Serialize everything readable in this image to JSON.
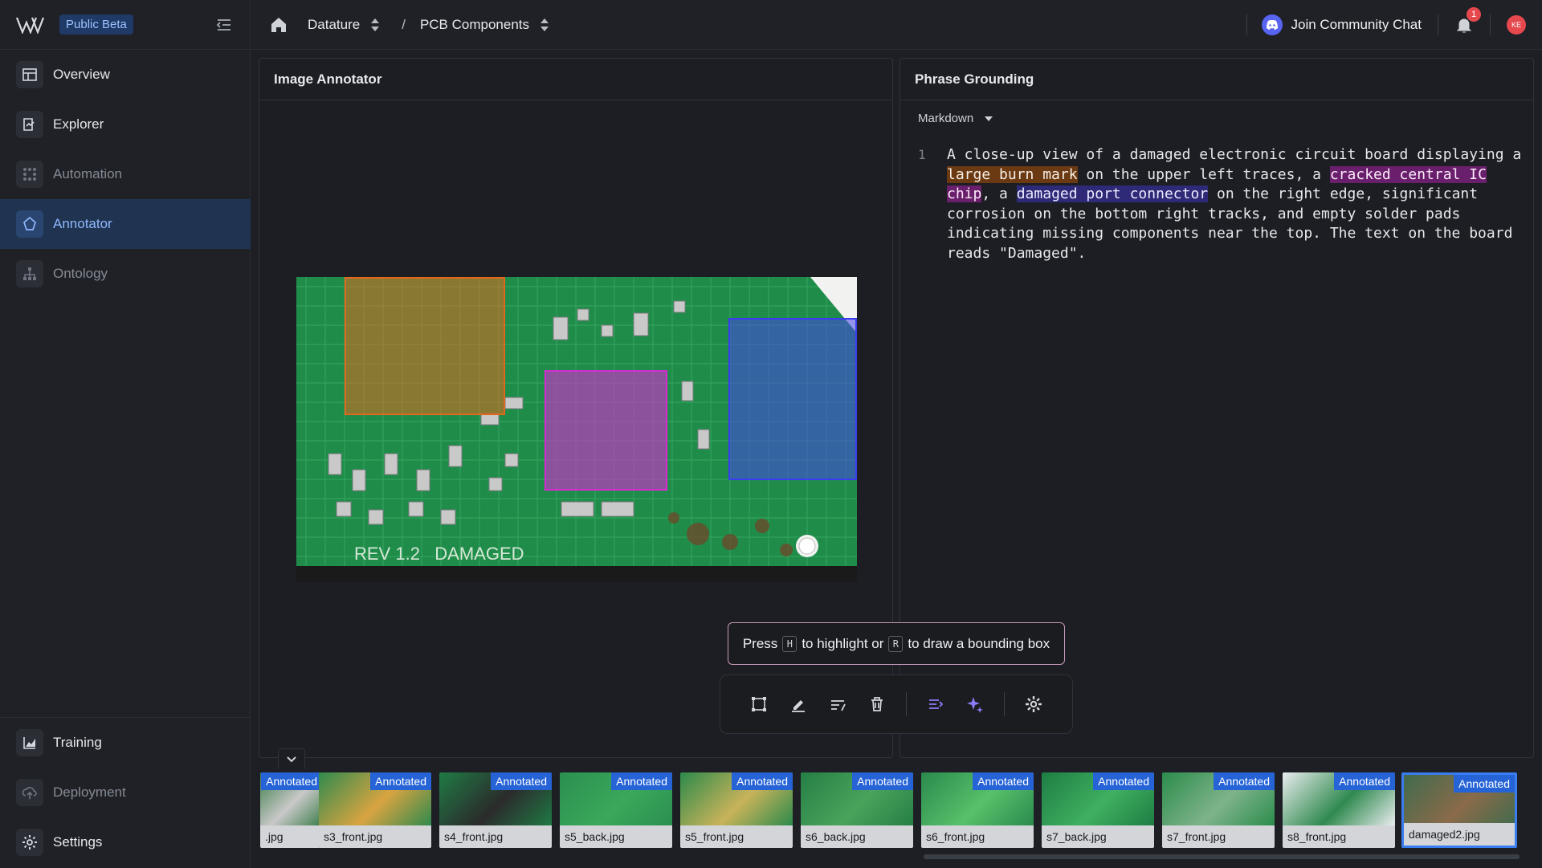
{
  "app": {
    "badge": "Public Beta"
  },
  "sidebar": {
    "items": [
      {
        "label": "Overview"
      },
      {
        "label": "Explorer"
      },
      {
        "label": "Automation"
      },
      {
        "label": "Annotator"
      },
      {
        "label": "Ontology"
      }
    ],
    "bottom_items": [
      {
        "label": "Training"
      },
      {
        "label": "Deployment"
      },
      {
        "label": "Settings"
      }
    ]
  },
  "topbar": {
    "breadcrumb": [
      "Datature",
      "PCB Components"
    ],
    "separator": "/",
    "community": "Join Community Chat",
    "notifications": "1",
    "avatar": "KE"
  },
  "annotator": {
    "title": "Image Annotator",
    "image_text": "REV 1.2   DAMAGED",
    "hint": {
      "prefix": "Press",
      "key1": "H",
      "middle": "to highlight or",
      "key2": "R",
      "suffix": "to draw a bounding box"
    }
  },
  "grounding": {
    "title": "Phrase Grounding",
    "format": "Markdown",
    "line_number": "1",
    "text": {
      "p1": "A close-up view of a damaged electronic circuit board displaying a ",
      "h1": "large burn mark",
      "p2": " on the upper left traces, a ",
      "h2": "cracked central IC chip",
      "p3": ", a ",
      "h3": "damaged port connector",
      "p4": " on the right edge, significant corrosion on the bottom right tracks, and empty solder pads indicating missing components near the top. The text on the board reads \"Damaged\"."
    }
  },
  "colors": {
    "burn": "#e0681e",
    "chip": "#d62bd2",
    "connector": "#3b3bf0",
    "accent": "#2563d6"
  },
  "filmstrip": {
    "status": "Annotated",
    "items": [
      {
        "name": ".jpg"
      },
      {
        "name": "s3_front.jpg"
      },
      {
        "name": "s4_front.jpg"
      },
      {
        "name": "s5_back.jpg"
      },
      {
        "name": "s5_front.jpg"
      },
      {
        "name": "s6_back.jpg"
      },
      {
        "name": "s6_front.jpg"
      },
      {
        "name": "s7_back.jpg"
      },
      {
        "name": "s7_front.jpg"
      },
      {
        "name": "s8_front.jpg"
      },
      {
        "name": "damaged2.jpg"
      }
    ]
  }
}
